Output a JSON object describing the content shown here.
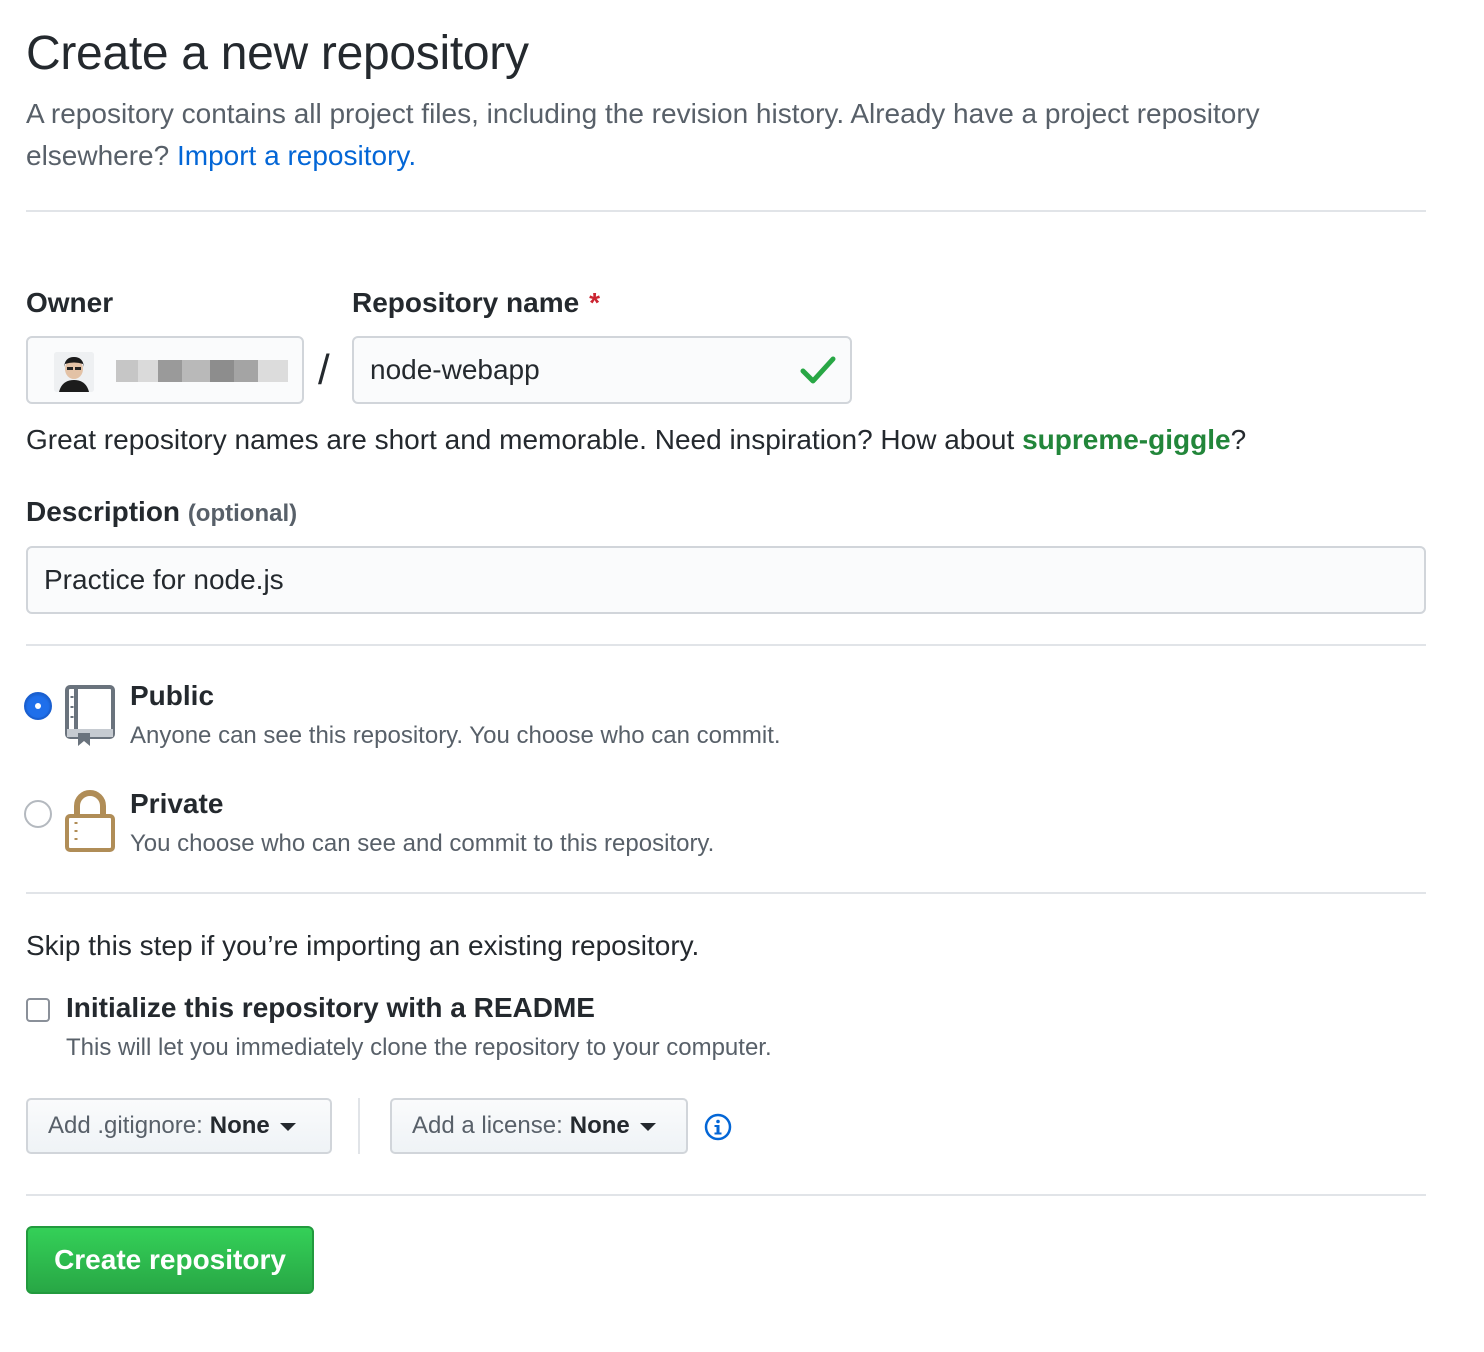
{
  "header": {
    "title": "Create a new repository",
    "description": "A repository contains all project files, including the revision history. Already have a project repository elsewhere?",
    "import_link": "Import a repository."
  },
  "owner": {
    "label": "Owner",
    "avatar_icon": "user-avatar"
  },
  "repo_name": {
    "label": "Repository name",
    "required_mark": "*",
    "separator": "/",
    "value": "node-webapp",
    "valid_icon": "checkmark-icon",
    "hint_prefix": "Great repository names are short and memorable. Need inspiration? How about",
    "suggestion": "supreme-giggle",
    "hint_suffix": "?"
  },
  "description": {
    "label": "Description",
    "optional_label": "(optional)",
    "value": "Practice for node.js"
  },
  "visibility": {
    "selected": "Public",
    "options": [
      {
        "title": "Public",
        "description": "Anyone can see this repository. You choose who can commit.",
        "icon": "repo-book-icon"
      },
      {
        "title": "Private",
        "description": "You choose who can see and commit to this repository.",
        "icon": "lock-icon"
      }
    ]
  },
  "init": {
    "skip_text": "Skip this step if you’re importing an existing repository.",
    "readme_label": "Initialize this repository with a README",
    "readme_desc": "This will let you immediately clone the repository to your computer.",
    "readme_checked": false
  },
  "selects": {
    "gitignore_prefix": "Add .gitignore:",
    "gitignore_value": "None",
    "license_prefix": "Add a license:",
    "license_value": "None",
    "info_icon": "info-icon"
  },
  "submit": {
    "label": "Create repository"
  },
  "colors": {
    "link": "#0366d6",
    "suggestion": "#22863a",
    "required": "#cb2431",
    "primary_button": "#28a745",
    "radio_selected": "#1f6feb",
    "private_icon": "#b08d57"
  }
}
